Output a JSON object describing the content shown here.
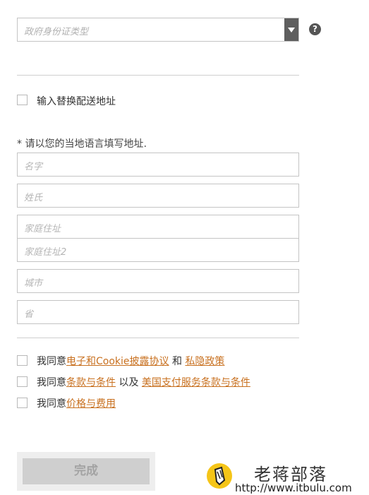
{
  "id_type": {
    "placeholder": "政府身份证类型",
    "help": "?"
  },
  "alt_address": {
    "label": "输入替换配送地址"
  },
  "note": "* 请以您的当地语言填写地址.",
  "fields": {
    "first_name": "名字",
    "last_name": "姓氏",
    "address1": "家庭住址",
    "address2": "家庭住址2",
    "city": "城市",
    "province": "省"
  },
  "agreements": [
    {
      "pre": "我同意",
      "link1": "电子和Cookie披露协议",
      "mid": " 和 ",
      "link2": "私隐政策"
    },
    {
      "pre": "我同意",
      "link1": "条款与条件",
      "mid": " 以及 ",
      "link2": "美国支付服务条款与条件"
    },
    {
      "pre": "我同意",
      "link1": "价格与费用"
    }
  ],
  "submit_label": "完成",
  "watermark": {
    "title": "老蒋部落",
    "url": "http://www.itbulu.com"
  },
  "colors": {
    "link": "#c8701f",
    "select_arrow_bg": "#5e5e5e",
    "button_bg": "#cfcfcf"
  }
}
